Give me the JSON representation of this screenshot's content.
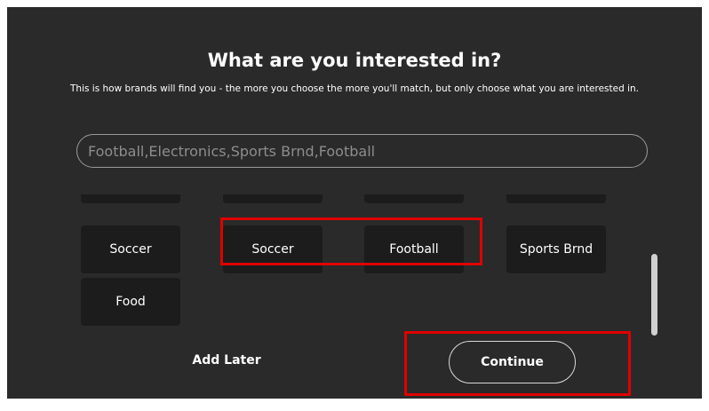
{
  "header": {
    "title": "What are you interested in?",
    "subtitle": "This is how brands will find you - the more you choose the more you'll match, but only choose what you are interested in."
  },
  "search": {
    "value": "Football,Electronics,Sports Brnd,Football"
  },
  "interests": {
    "row_partial": [
      "",
      "",
      "",
      ""
    ],
    "row1": [
      "Soccer",
      "Soccer",
      "Football",
      "Sports Brnd"
    ],
    "row2": [
      "Food"
    ]
  },
  "footer": {
    "add_later_label": "Add Later",
    "continue_label": "Continue"
  },
  "colors": {
    "background": "#2a2a2a",
    "chip": "#1c1c1c",
    "highlight": "#e00000"
  }
}
